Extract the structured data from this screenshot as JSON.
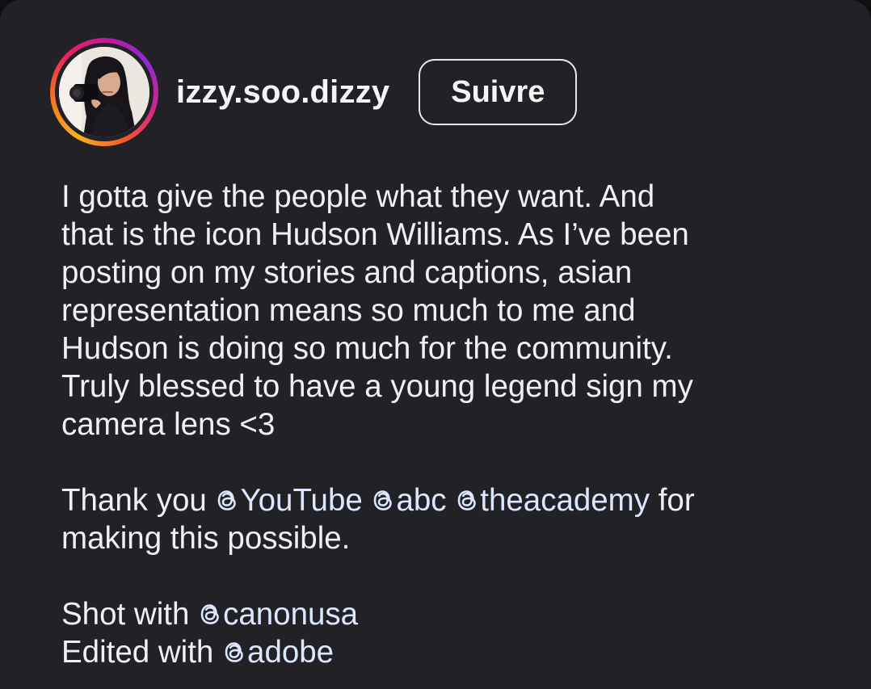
{
  "post": {
    "username": "izzy.soo.dizzy",
    "follow_label": "Suivre",
    "caption_lines": [
      "I gotta give the people what they want. And",
      "that is the icon Hudson Williams. As I’ve been",
      "posting on my stories and captions, asian",
      "representation means so much to me and",
      "Hudson is doing so much for the community.",
      "Truly blessed to have a young legend sign my",
      "camera lens <3"
    ],
    "thanks": {
      "prefix": "Thank you",
      "mention_1": "YouTube",
      "mention_2": "abc",
      "mention_3": "theacademy",
      "suffix": "for",
      "line2": "making this possible."
    },
    "shot": {
      "prefix": "Shot with",
      "mention": "canonusa"
    },
    "edited": {
      "prefix": "Edited with",
      "mention": "adobe"
    }
  },
  "icons": {
    "mention_icon": "threads-icon",
    "avatar": "profile-photo-avatar"
  },
  "colors": {
    "background": "#222226",
    "text": "#f0f0f3",
    "mention": "#dde6ff",
    "ring_start": "#fbb01f",
    "ring_mid": "#e8245b",
    "ring_end": "#8a2bd5"
  }
}
